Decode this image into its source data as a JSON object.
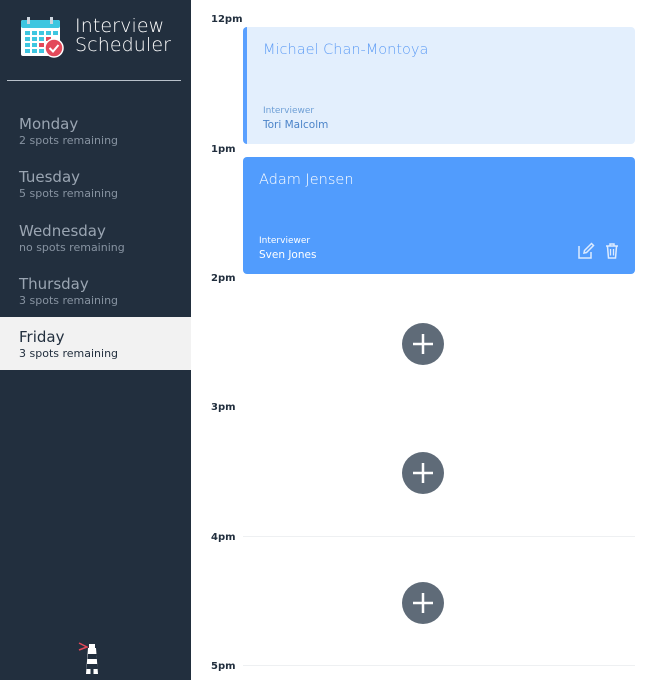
{
  "app": {
    "title_line1": "Interview",
    "title_line2": "Scheduler",
    "logo_icon": "calendar-check-icon",
    "footer_icon": "lighthouse-icon"
  },
  "sidebar": {
    "days": [
      {
        "name": "Monday",
        "spots": "2 spots remaining",
        "selected": false
      },
      {
        "name": "Tuesday",
        "spots": "5 spots remaining",
        "selected": false
      },
      {
        "name": "Wednesday",
        "spots": "no spots remaining",
        "selected": false
      },
      {
        "name": "Thursday",
        "spots": "3 spots remaining",
        "selected": false
      },
      {
        "name": "Friday",
        "spots": "3 spots remaining",
        "selected": true
      }
    ]
  },
  "schedule": {
    "slots": [
      {
        "time": "12pm",
        "appointment": {
          "student": "Michael Chan-Montoya",
          "interviewer_caption": "Interviewer",
          "interviewer": "Tori Malcolm",
          "style": "light"
        }
      },
      {
        "time": "1pm",
        "appointment": {
          "student": "Adam Jensen",
          "interviewer_caption": "Interviewer",
          "interviewer": "Sven Jones",
          "style": "dark"
        }
      },
      {
        "time": "2pm",
        "appointment": null
      },
      {
        "time": "3pm",
        "appointment": null
      },
      {
        "time": "4pm",
        "appointment": null
      },
      {
        "time": "5pm",
        "appointment": null
      }
    ]
  },
  "colors": {
    "sidebar_bg": "#222f3e",
    "accent_blue": "#519cfd",
    "light_blue": "#e3effd",
    "add_button": "#5f6b78",
    "selected_bg": "#f2f2f2"
  }
}
